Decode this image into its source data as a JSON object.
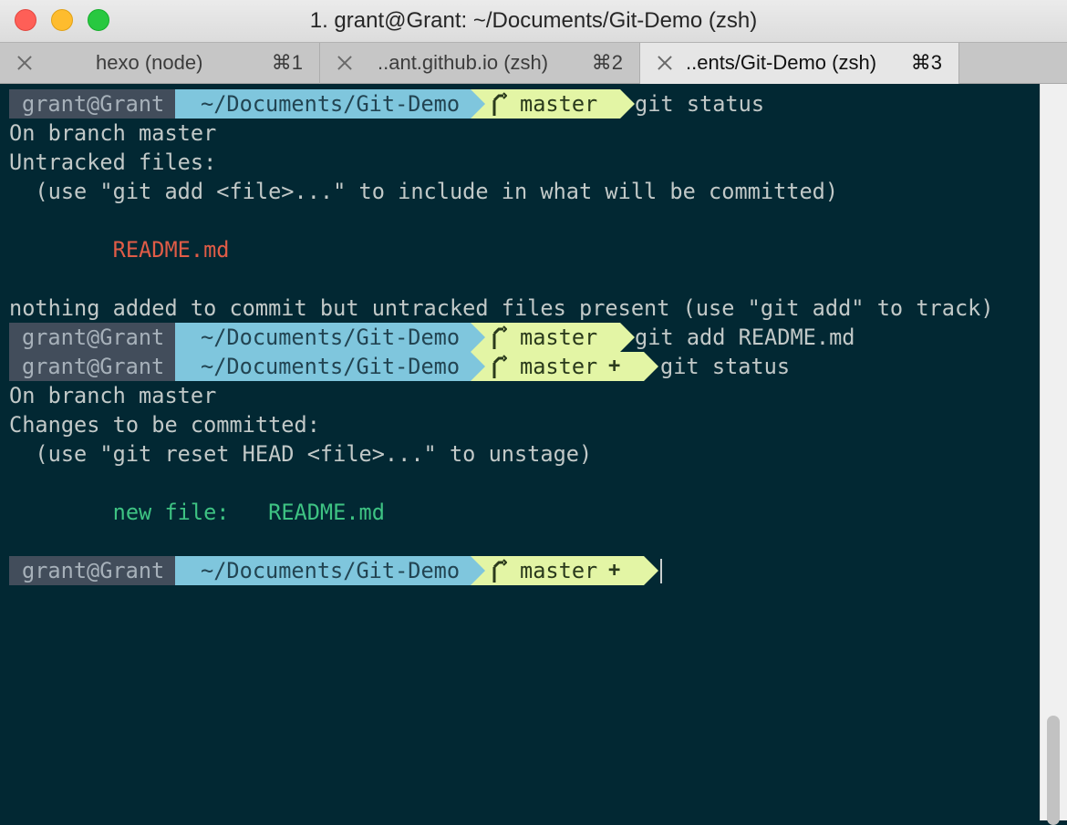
{
  "window": {
    "title": "1. grant@Grant: ~/Documents/Git-Demo (zsh)"
  },
  "tabs": [
    {
      "label": "hexo (node)",
      "shortcut": "⌘1",
      "active": false
    },
    {
      "label": "..ant.github.io (zsh)",
      "shortcut": "⌘2",
      "active": false
    },
    {
      "label": "..ents/Git-Demo (zsh)",
      "shortcut": "⌘3",
      "active": true
    }
  ],
  "colors": {
    "background": "#022833",
    "prompt_user_bg": "#424d5b",
    "prompt_path_bg": "#7fc6dd",
    "prompt_git_bg": "#e3f5a5",
    "untracked_file": "#e15c47",
    "staged_file": "#3ec383"
  },
  "prompt": {
    "user": "grant@Grant",
    "path": "~/Documents/Git-Demo",
    "branch": "master",
    "dirty_mark": "+",
    "branch_icon": "git-branch-icon"
  },
  "terminal": {
    "p1_cmd": "git status",
    "o1": "On branch master",
    "o2": "Untracked files:",
    "o3": "  (use \"git add <file>...\" to include in what will be committed)",
    "o4": "        README.md",
    "o5": "nothing added to commit but untracked files present (use \"git add\" to track)",
    "p2_cmd": "git add README.md",
    "p3_cmd": "git status",
    "o6": "On branch master",
    "o7": "Changes to be committed:",
    "o8": "  (use \"git reset HEAD <file>...\" to unstage)",
    "o9_label": "        new file:",
    "o9_file": "README.md"
  }
}
